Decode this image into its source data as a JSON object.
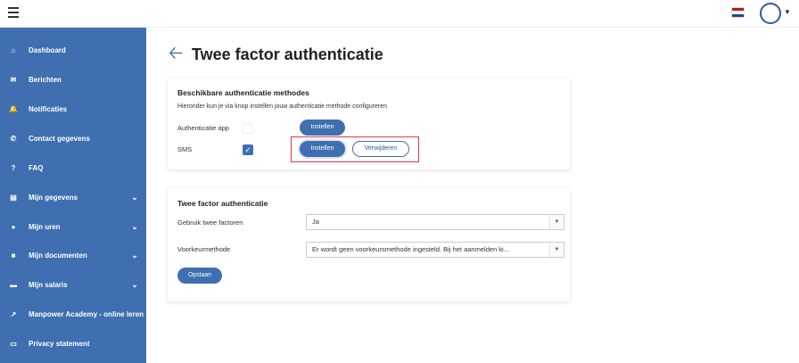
{
  "topbar": {
    "flag_colors": [
      "#ae1c28",
      "#ffffff",
      "#21468b"
    ],
    "menu_icon": "hamburger-icon",
    "avatar_icon": "user-avatar-icon"
  },
  "sidebar": {
    "items": [
      {
        "label": "Dashboard",
        "icon": "home-icon",
        "chevron": false
      },
      {
        "label": "Berichten",
        "icon": "envelope-icon",
        "chevron": false
      },
      {
        "label": "Notificaties",
        "icon": "bell-icon",
        "chevron": false
      },
      {
        "label": "Contact gegevens",
        "icon": "phone-icon",
        "chevron": false
      },
      {
        "label": "FAQ",
        "icon": "question-icon",
        "chevron": false
      },
      {
        "label": "Mijn gegevens",
        "icon": "id-card-icon",
        "chevron": true
      },
      {
        "label": "Mijn uren",
        "icon": "user-clock-icon",
        "chevron": true
      },
      {
        "label": "Mijn documenten",
        "icon": "folder-icon",
        "chevron": true
      },
      {
        "label": "Mijn salaris",
        "icon": "credit-card-icon",
        "chevron": true
      },
      {
        "label": "Manpower Academy - online leren",
        "icon": "external-link-icon",
        "chevron": false
      },
      {
        "label": "Privacy statement",
        "icon": "monitor-icon",
        "chevron": false
      }
    ]
  },
  "page": {
    "title": "Twee factor authenticatie"
  },
  "methods": {
    "title": "Beschikbare authenticatie methodes",
    "subtitle": "Hieronder kun je via knop instellen jouw authenticatie methode configureren",
    "app_label": "Authenticatie app",
    "app_button": "Instellen",
    "sms_label": "SMS",
    "sms_button": "Instellen",
    "sms_remove_button": "Verwijderen"
  },
  "twofactor": {
    "title": "Twee factor authenticatie",
    "use_label": "Gebruik twee factoren",
    "use_value": "Ja",
    "pref_label": "Voorkeurmethode",
    "pref_value": "Er wordt geen voorkeursmethode ingesteld. Bij het aanmelden ki…",
    "save_button": "Opslaan"
  },
  "colors": {
    "primary": "#3f6fb0",
    "highlight": "#e0393e"
  }
}
